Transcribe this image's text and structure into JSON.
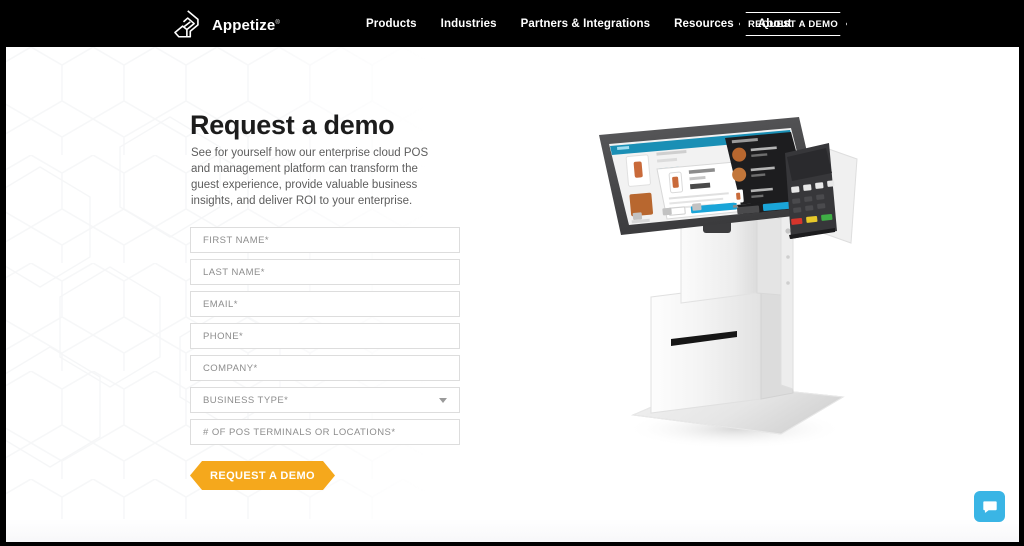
{
  "header": {
    "brand": {
      "logo_icon": "appetize-a-logo-icon",
      "name": "Appetize",
      "trademark": "®"
    },
    "nav_items": [
      {
        "label": "Products"
      },
      {
        "label": "Industries"
      },
      {
        "label": "Partners & Integrations"
      },
      {
        "label": "Resources"
      },
      {
        "label": "About"
      }
    ],
    "cta_label": "REQUEST A DEMO",
    "background_color": "#000000",
    "text_color": "#ffffff"
  },
  "main": {
    "headline": "Request a demo",
    "subcopy": "See for yourself how our enterprise cloud POS and management platform can transform the guest experience, provide valuable business insights, and deliver ROI to your enterprise.",
    "form": {
      "fields": [
        {
          "label": "FIRST NAME*",
          "type": "text",
          "value": ""
        },
        {
          "label": "LAST NAME*",
          "type": "text",
          "value": ""
        },
        {
          "label": "EMAIL*",
          "type": "email",
          "value": ""
        },
        {
          "label": "PHONE*",
          "type": "tel",
          "value": ""
        },
        {
          "label": "COMPANY*",
          "type": "text",
          "value": ""
        },
        {
          "label": "BUSINESS TYPE*",
          "type": "select",
          "value": ""
        },
        {
          "label": "# OF POS TERMINALS OR LOCATIONS*",
          "type": "text",
          "value": ""
        }
      ],
      "submit_label": "REQUEST A DEMO",
      "submit_color": "#f5a81c",
      "field_border_color": "#dddddd",
      "placeholder_color": "#8d8d8d"
    },
    "product_image": {
      "alt": "Self-service ordering kiosk with touchscreen POS display and card payment terminal",
      "icon": "pos-kiosk-image"
    }
  },
  "chat_widget": {
    "icon": "chat-bubble-icon",
    "color": "#3ab5e5"
  }
}
